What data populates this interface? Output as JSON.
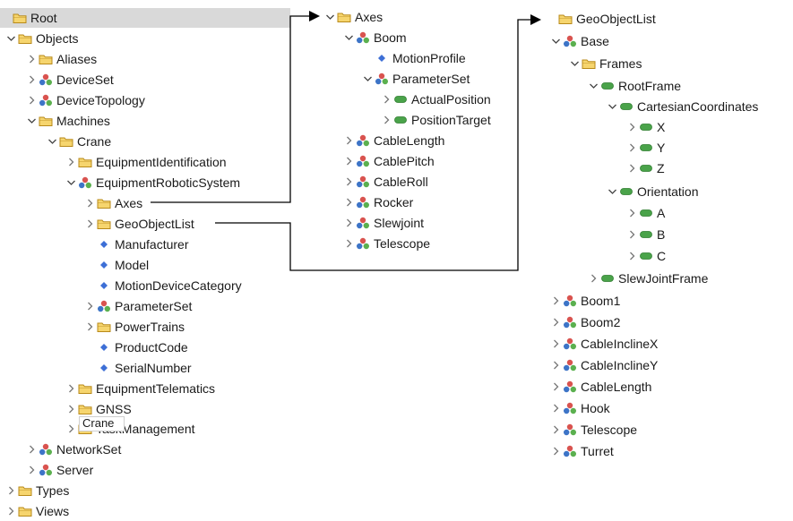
{
  "left_tree": {
    "root": "Root",
    "objects": "Objects",
    "aliases": "Aliases",
    "deviceset": "DeviceSet",
    "devicetopology": "DeviceTopology",
    "machines": "Machines",
    "crane": "Crane",
    "equipmentidentification": "EquipmentIdentification",
    "equipmentroboticsystem": "EquipmentRoboticSystem",
    "axes": "Axes",
    "geoobjectlist": "GeoObjectList",
    "manufacturer": "Manufacturer",
    "model": "Model",
    "motiondevicecategory": "MotionDeviceCategory",
    "parameterset": "ParameterSet",
    "powertrains": "PowerTrains",
    "productcode": "ProductCode",
    "serialnumber": "SerialNumber",
    "equipmenttelematics": "EquipmentTelematics",
    "gnss": "GNSS",
    "taskmanagement": "TaskManagement",
    "networkset": "NetworkSet",
    "server": "Server",
    "types": "Types",
    "views": "Views"
  },
  "tooltip": {
    "text": "Crane"
  },
  "axes_tree": {
    "axes": "Axes",
    "boom": "Boom",
    "motionprofile": "MotionProfile",
    "parameterset": "ParameterSet",
    "actualposition": "ActualPosition",
    "positiontarget": "PositionTarget",
    "cablelength": "CableLength",
    "cablepitch": "CablePitch",
    "cableroll": "CableRoll",
    "rocker": "Rocker",
    "slewjoint": "Slewjoint",
    "telescope": "Telescope"
  },
  "geo_tree": {
    "geoobjectlist": "GeoObjectList",
    "base": "Base",
    "frames": "Frames",
    "rootframe": "RootFrame",
    "cartesiancoordinates": "CartesianCoordinates",
    "x": "X",
    "y": "Y",
    "z": "Z",
    "orientation": "Orientation",
    "a": "A",
    "b": "B",
    "c": "C",
    "slewjointframe": "SlewJointFrame",
    "boom1": "Boom1",
    "boom2": "Boom2",
    "cableinclinex": "CableInclineX",
    "cableincliney": "CableInclineY",
    "cablelength": "CableLength",
    "hook": "Hook",
    "telescope": "Telescope",
    "turret": "Turret"
  },
  "icons": {
    "folder_fill": "#f6d56e",
    "folder_stroke": "#b88a1a",
    "object_red": "#d9534f",
    "object_blue": "#3d74c7",
    "object_green": "#5bb04f",
    "property": "#3d6fd6",
    "variable": "#4aa34a",
    "connector": "#000000"
  }
}
